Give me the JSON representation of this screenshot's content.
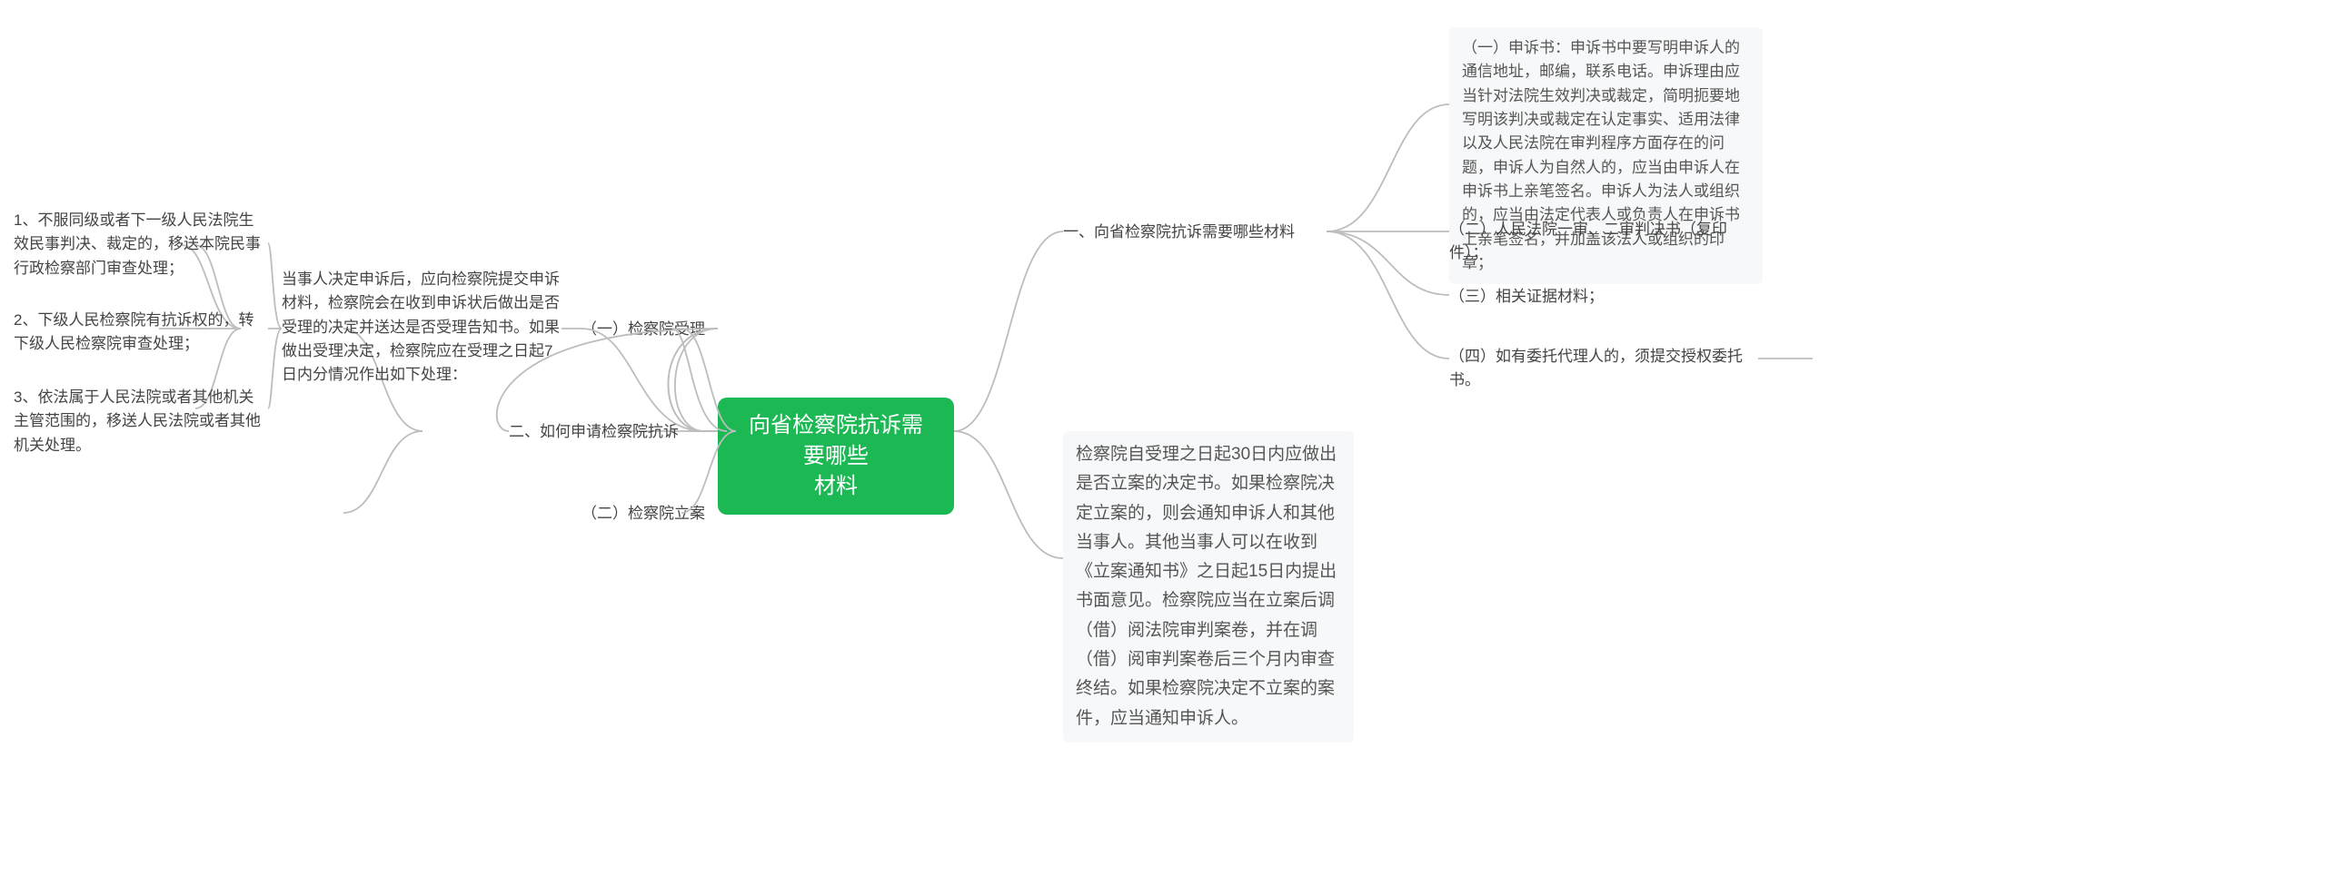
{
  "center": {
    "title_line1": "向省检察院抗诉需要哪些",
    "title_line2": "材料"
  },
  "right": {
    "branch1": {
      "label": "一、向省检察院抗诉需要哪些材料",
      "items": {
        "i1": "（一）申诉书：申诉书中要写明申诉人的通信地址，邮编，联系电话。申诉理由应当针对法院生效判决或裁定，简明扼要地写明该判决或裁定在认定事实、适用法律以及人民法院在审判程序方面存在的问题，申诉人为自然人的，应当由申诉人在申诉书上亲笔签名。申诉人为法人或组织的，应当由法定代表人或负责人在申诉书上亲笔签名，并加盖该法人或组织的印章；",
        "i2": "（二）人民法院一审、二审判决书（复印件）；",
        "i3": "（三）相关证据材料；",
        "i4": "（四）如有委托代理人的，须提交授权委托书。"
      }
    },
    "branch2": {
      "text": "检察院自受理之日起30日内应做出是否立案的决定书。如果检察院决定立案的，则会通知申诉人和其他当事人。其他当事人可以在收到《立案通知书》之日起15日内提出书面意见。检察院应当在立案后调（借）阅法院审判案卷，并在调（借）阅审判案卷后三个月内审查终结。如果检察院决定不立案的案件，应当通知申诉人。"
    }
  },
  "left": {
    "branch_label": "二、如何申请检察院抗诉",
    "sub1": {
      "label": "（一）检察院受理",
      "intro": "当事人决定申诉后，应向检察院提交申诉材料，检察院会在收到申诉状后做出是否受理的决定并送达是否受理告知书。如果做出受理决定，检察院应在受理之日起7日内分情况作出如下处理：",
      "items": {
        "i1": "1、不服同级或者下一级人民法院生效民事判决、裁定的，移送本院民事行政检察部门审查处理；",
        "i2": "2、下级人民检察院有抗诉权的，转下级人民检察院审查处理；",
        "i3": "3、依法属于人民法院或者其他机关主管范围的，移送人民法院或者其他机关处理。"
      }
    },
    "sub2": {
      "label": "（二）检察院立案"
    }
  }
}
